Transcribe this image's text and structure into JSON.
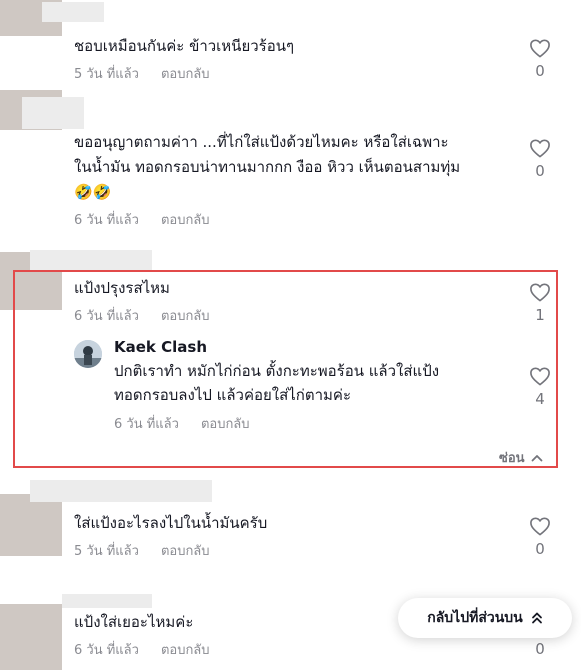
{
  "comments": [
    {
      "text": "ชอบเหมือนกันค่ะ ข้าวเหนียวร้อนๆ",
      "time": "5 วัน ที่แล้ว",
      "reply_label": "ตอบกลับ",
      "likes": "0"
    },
    {
      "text_line1": "ขออนุญาตถามค่าา ...ที่ไก่ใส่แป้งด้วยไหมคะ หรือใส่เฉพาะ",
      "text_line2": "ในน้ำมัน ทอดกรอบน่าทานมากกก งืออ หิวว เห็นตอนสามทุ่ม",
      "emoji": "🤣🤣",
      "time": "6 วัน ที่แล้ว",
      "reply_label": "ตอบกลับ",
      "likes": "0"
    },
    {
      "text": "แป้งปรุงรสไหม",
      "time": "6 วัน ที่แล้ว",
      "reply_label": "ตอบกลับ",
      "likes": "1"
    },
    {
      "text": "ใส่แป้งอะไรลงไปในน้ำมันครับ",
      "time": "5 วัน ที่แล้ว",
      "reply_label": "ตอบกลับ",
      "likes": "0"
    },
    {
      "text": "แป้งใส่เยอะไหมค่ะ",
      "time": "6 วัน ที่แล้ว",
      "reply_label": "ตอบกลับ",
      "likes": "0"
    }
  ],
  "reply": {
    "author": "Kaek Clash",
    "text_line1": "ปกติเราทำ หมักไก่ก่อน ตั้งกะทะพอร้อน แล้วใส่แป้ง",
    "text_line2": "ทอดกรอบลงไป แล้วค่อยใส่ไก่ตามค่ะ",
    "time": "6 วัน ที่แล้ว",
    "reply_label": "ตอบกลับ",
    "likes": "4"
  },
  "hide_label": "ซ่อน",
  "back_to_top_label": "กลับไปที่ส่วนบน",
  "colors": {
    "highlight_border": "#e24a4a",
    "meta_text": "#8a8b91"
  },
  "icons": {
    "like": "heart-outline-icon",
    "hide": "chevron-up-icon",
    "back_to_top": "double-chevron-up-icon"
  }
}
